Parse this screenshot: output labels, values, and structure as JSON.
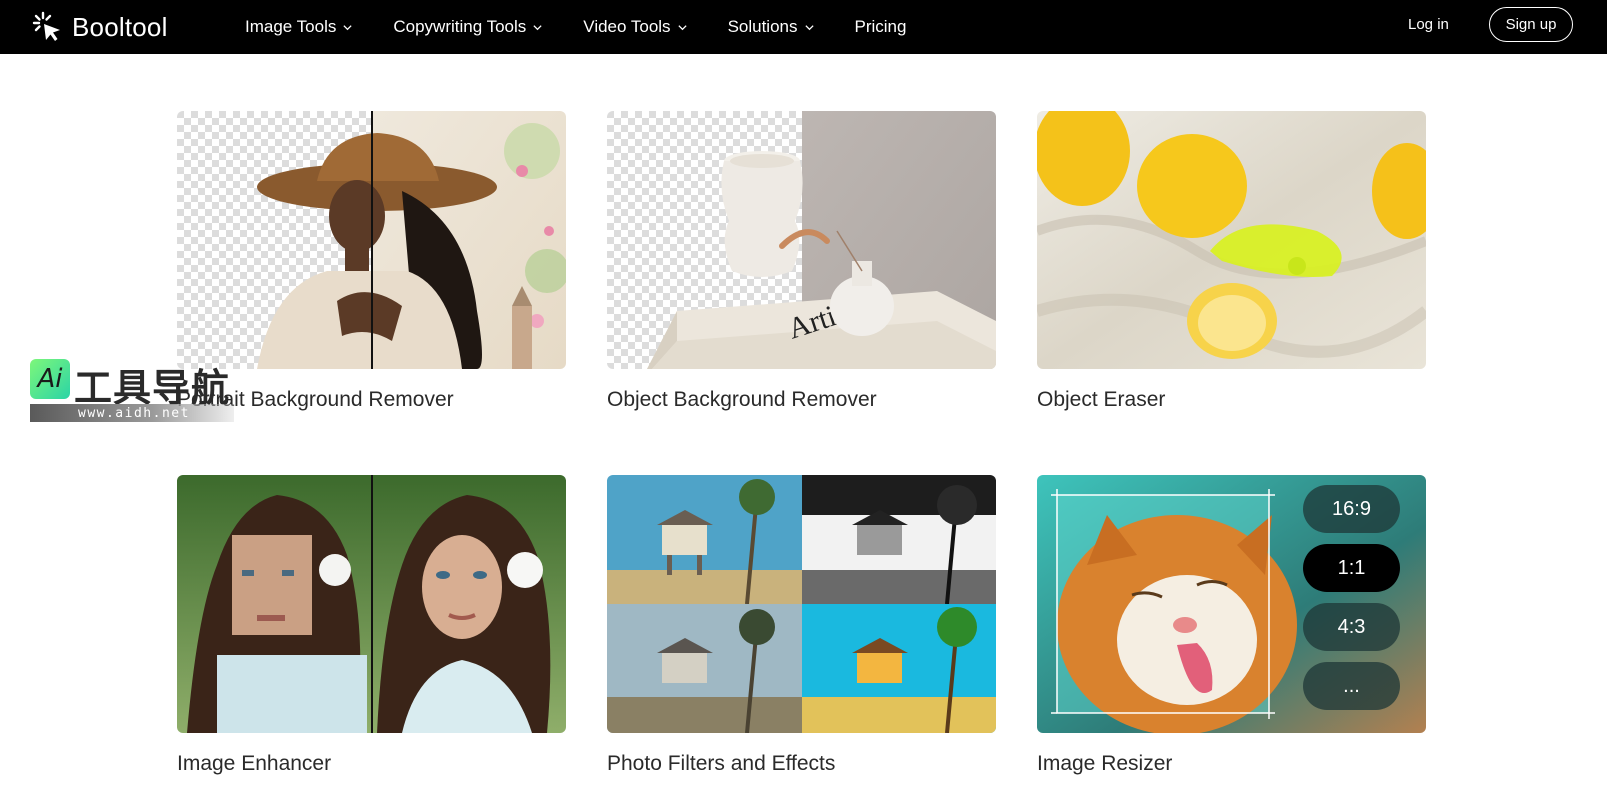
{
  "header": {
    "brand": "Booltool",
    "nav": [
      {
        "label": "Image Tools",
        "dropdown": true
      },
      {
        "label": "Copywriting Tools",
        "dropdown": true
      },
      {
        "label": "Video Tools",
        "dropdown": true
      },
      {
        "label": "Solutions",
        "dropdown": true
      },
      {
        "label": "Pricing",
        "dropdown": false
      }
    ],
    "login": "Log in",
    "signup": "Sign up"
  },
  "tools": [
    {
      "title": "Portrait Background Remover"
    },
    {
      "title": "Object Background Remover"
    },
    {
      "title": "Object Eraser"
    },
    {
      "title": "Image Enhancer"
    },
    {
      "title": "Photo Filters and Effects"
    },
    {
      "title": "Image Resizer",
      "ratios": [
        "16:9",
        "1:1",
        "4:3",
        "..."
      ],
      "active_ratio": "1:1"
    }
  ],
  "watermark": {
    "logo": "Ai",
    "text": "工具导航",
    "url": "www.aidh.net"
  }
}
